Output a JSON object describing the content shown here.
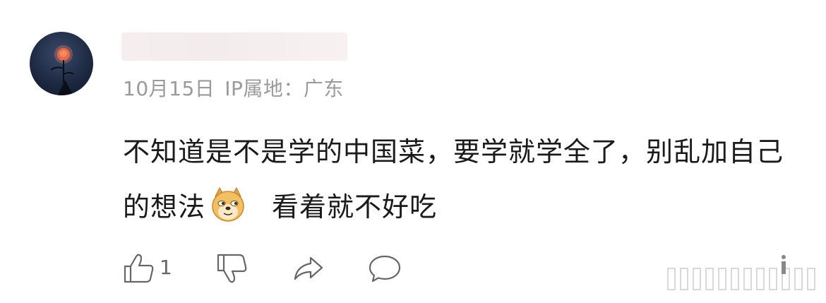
{
  "comment": {
    "date": "10月15日",
    "ip_location": "IP属地：广东",
    "text_before_emoji": "不知道是不是学的中国菜，要学就学全了，别乱加自己的想法",
    "text_after_emoji": "看着就不好吃",
    "emoji": "doge-emoji"
  },
  "actions": {
    "like_count": "1",
    "icons": [
      "thumbs-up-icon",
      "thumbs-down-icon",
      "share-icon",
      "comment-icon"
    ]
  }
}
